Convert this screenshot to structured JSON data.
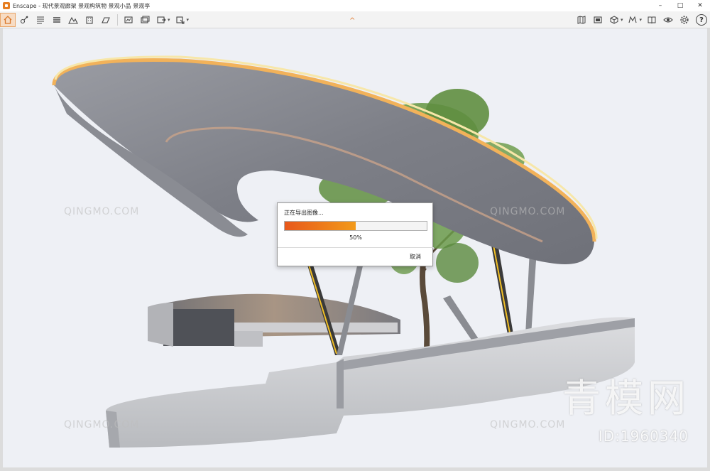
{
  "window": {
    "app_name": "Enscape",
    "title": "Enscape - 现代景观廊架 景观构筑物 景观小品 景观亭",
    "minimize": "–",
    "maximize": "□",
    "close": "✕"
  },
  "toolbar": {
    "left_icons": [
      "home-icon",
      "orbit-icon",
      "list-icon",
      "layers-icon",
      "mountain-icon",
      "building-icon",
      "floor-icon",
      "screenshot-icon",
      "batch-render-icon",
      "export-icon",
      "settings-export-icon"
    ],
    "right_icons": [
      "map-icon",
      "gallery-icon",
      "cube-icon",
      "view-icon",
      "book-icon",
      "visibility-icon",
      "gear-icon"
    ],
    "help_label": "?",
    "collapse_glyph": "^"
  },
  "export_dialog": {
    "title": "正在导出图像...",
    "progress": 0.5,
    "progress_text": "50%",
    "cancel_label": "取消"
  },
  "watermark": {
    "brand": "青模网",
    "id_text": "ID:1960340",
    "site": "QINGMO.COM"
  },
  "colors": {
    "progress_start": "#e8581b",
    "progress_end": "#f29a1a",
    "accent": "#e67e22"
  }
}
